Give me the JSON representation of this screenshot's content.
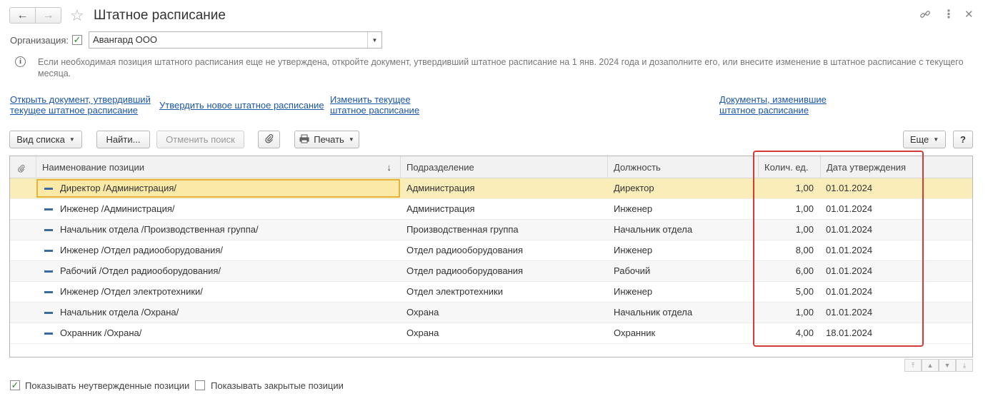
{
  "window": {
    "title": "Штатное расписание",
    "back_icon": "←",
    "forward_icon": "→",
    "star_icon": "☆",
    "link_icon": "🔗",
    "more_icon": "⋮",
    "close_icon": "✕"
  },
  "organization": {
    "label": "Организация:",
    "value": "Авангард ООО"
  },
  "info": {
    "text": "Если необходимая позиция штатного расписания еще не утверждена, откройте документ, утвердивший штатное расписание на 1 янв. 2024 года и дозаполните его, или внесите изменение в штатное расписание с текущего месяца."
  },
  "links": {
    "open_doc_line1": "Открыть документ, утвердивший",
    "open_doc_line2": "текущее штатное расписание",
    "approve_new": "Утвердить новое штатное расписание",
    "change_line1": "Изменить текущее",
    "change_line2": "штатное расписание",
    "docs_line1": "Документы, изменившие",
    "docs_line2": "штатное расписание"
  },
  "toolbar": {
    "view_list": "Вид списка",
    "find": "Найти...",
    "cancel_search": "Отменить поиск",
    "print": "Печать",
    "more": "Еще",
    "help": "?"
  },
  "table": {
    "columns": {
      "name": "Наименование позиции",
      "department": "Подразделение",
      "position": "Должность",
      "qty": "Колич. ед.",
      "date": "Дата утверждения",
      "sort_indicator": "↓"
    },
    "rows": [
      {
        "name": "Директор /Администрация/",
        "department": "Администрация",
        "position": "Директор",
        "qty": "1,00",
        "date": "01.01.2024"
      },
      {
        "name": "Инженер /Администрация/",
        "department": "Администрация",
        "position": "Инженер",
        "qty": "1,00",
        "date": "01.01.2024"
      },
      {
        "name": "Начальник отдела /Производственная группа/",
        "department": "Производственная группа",
        "position": "Начальник отдела",
        "qty": "1,00",
        "date": "01.01.2024"
      },
      {
        "name": "Инженер /Отдел радиооборудования/",
        "department": "Отдел радиооборудования",
        "position": "Инженер",
        "qty": "8,00",
        "date": "01.01.2024"
      },
      {
        "name": "Рабочий /Отдел радиооборудования/",
        "department": "Отдел радиооборудования",
        "position": "Рабочий",
        "qty": "6,00",
        "date": "01.01.2024"
      },
      {
        "name": "Инженер /Отдел электротехники/",
        "department": "Отдел электротехники",
        "position": "Инженер",
        "qty": "5,00",
        "date": "01.01.2024"
      },
      {
        "name": "Начальник отдела /Охрана/",
        "department": "Охрана",
        "position": "Начальник отдела",
        "qty": "1,00",
        "date": "01.01.2024"
      },
      {
        "name": "Охранник /Охрана/",
        "department": "Охрана",
        "position": "Охранник",
        "qty": "4,00",
        "date": "18.01.2024"
      }
    ]
  },
  "footer": {
    "show_unapproved": "Показывать неутвержденные позиции",
    "show_unapproved_checked": true,
    "show_closed": "Показывать закрытые позиции",
    "show_closed_checked": false
  },
  "colors": {
    "accent_link": "#1b56a8",
    "selected_row": "#fbedb9",
    "highlight_border": "#d33b3b"
  }
}
